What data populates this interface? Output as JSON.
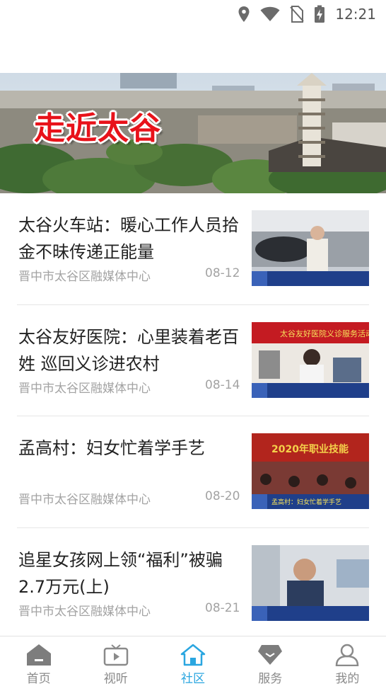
{
  "status_bar": {
    "time": "12:21"
  },
  "banner": {
    "title": "走近太谷"
  },
  "news": [
    {
      "title": "太谷火车站：暖心工作人员拾金不昧传递正能量",
      "source": "晋中市太谷区融媒体中心",
      "date": "08-12"
    },
    {
      "title": "太谷友好医院：心里装着老百姓 巡回义诊进农村",
      "source": "晋中市太谷区融媒体中心",
      "date": "08-14"
    },
    {
      "title": "孟高村：妇女忙着学手艺",
      "source": "晋中市太谷区融媒体中心",
      "date": "08-20"
    },
    {
      "title": "追星女孩网上领“福利”被骗2.7万元(上)",
      "source": "晋中市太谷区融媒体中心",
      "date": "08-21"
    }
  ],
  "thumb_text": {
    "t2_banner": "太谷友好医院义诊服务活动",
    "t3_banner": "2020年职业技能",
    "t3_caption": "孟高村：妇女忙着学手艺"
  },
  "tabs": [
    {
      "label": "首页",
      "icon": "home-icon"
    },
    {
      "label": "视听",
      "icon": "tv-icon"
    },
    {
      "label": "社区",
      "icon": "community-icon"
    },
    {
      "label": "服务",
      "icon": "diamond-icon"
    },
    {
      "label": "我的",
      "icon": "user-icon"
    }
  ],
  "colors": {
    "accent": "#2aa6e0",
    "banner_text": "#e8121a",
    "tab_inactive": "#8a8a8a"
  }
}
